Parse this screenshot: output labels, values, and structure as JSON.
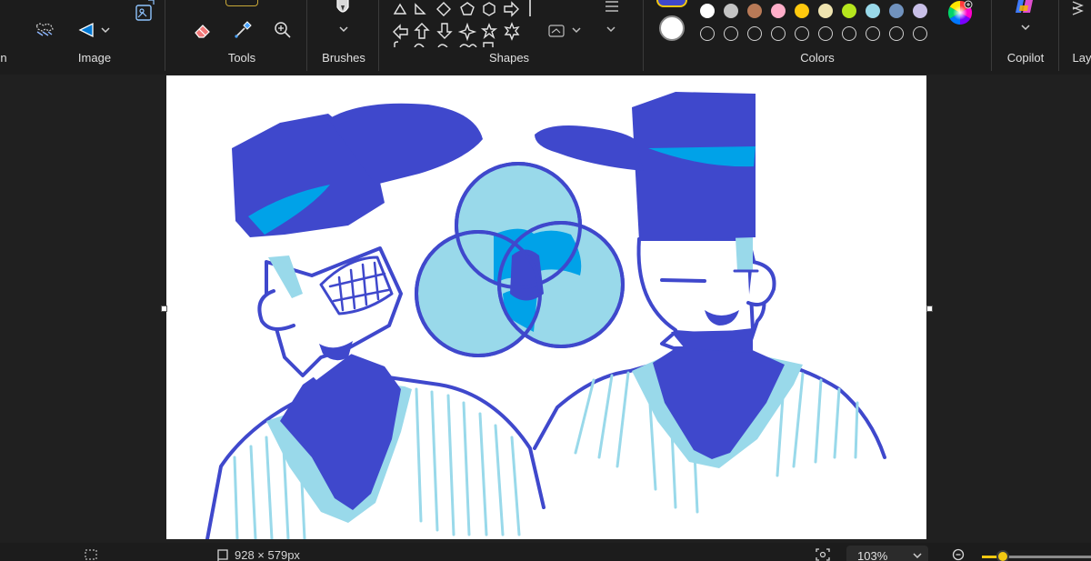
{
  "ribbon": {
    "groups": {
      "image": "Image",
      "tools": "Tools",
      "brushes": "Brushes",
      "shapes": "Shapes",
      "colors": "Colors",
      "copilot": "Copilot",
      "layers": "Lay"
    },
    "left_cut_label": "n"
  },
  "colors": {
    "primary": "#3f48cc",
    "secondary": "#ffffff",
    "palette": [
      "#ffffff",
      "#c3c3c3",
      "#b97a57",
      "#ffaec9",
      "#ffc90e",
      "#efe4b0",
      "#b5e61d",
      "#99d9ea",
      "#7092be",
      "#c8bfe7"
    ],
    "accent": "#f2c811"
  },
  "canvas": {
    "colors": {
      "dark_blue": "#3f48cc",
      "light_blue": "#99d9ea",
      "mid_blue": "#00a2e8",
      "background": "#ffffff"
    }
  },
  "status": {
    "canvas_size": "928 × 579px",
    "zoom": "103%"
  }
}
